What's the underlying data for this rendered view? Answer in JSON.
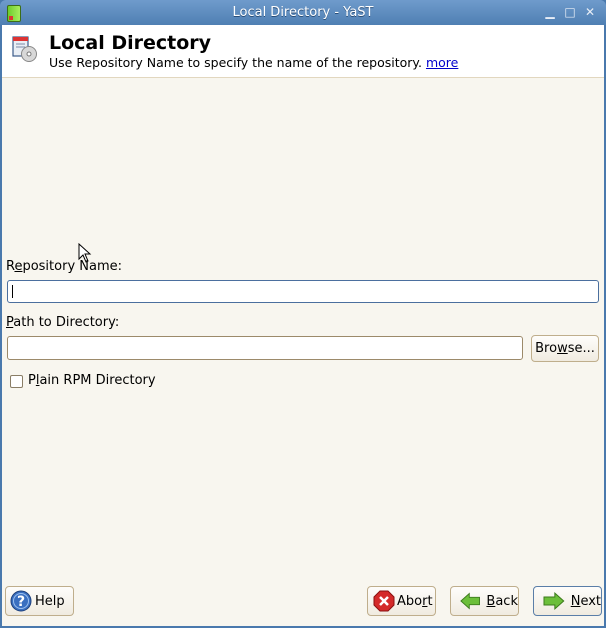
{
  "window": {
    "title": "Local Directory - YaST",
    "controls": [
      "minimize",
      "maximize",
      "close"
    ]
  },
  "header": {
    "title": "Local Directory",
    "subtitle": "Use Repository Name to specify the name of the repository.",
    "more_link": "more",
    "icon": "local-directory-icon"
  },
  "form": {
    "repo_name": {
      "label_pre": "R",
      "label_mnemonic": "e",
      "label_post": "pository Name:",
      "value": ""
    },
    "path": {
      "label_mnemonic": "P",
      "label_post": "ath to Directory:",
      "value": ""
    },
    "browse_button": {
      "pre": "Bro",
      "mnemonic": "w",
      "post": "se..."
    },
    "plain_rpm": {
      "pre": "P",
      "mnemonic": "l",
      "post": "ain RPM Directory",
      "checked": false
    }
  },
  "footer": {
    "help": "Help",
    "abort": {
      "pre": "Abo",
      "mnemonic": "r",
      "post": "t"
    },
    "back": {
      "mnemonic": "B",
      "post": "ack"
    },
    "next": {
      "mnemonic": "N",
      "post": "ext"
    }
  }
}
